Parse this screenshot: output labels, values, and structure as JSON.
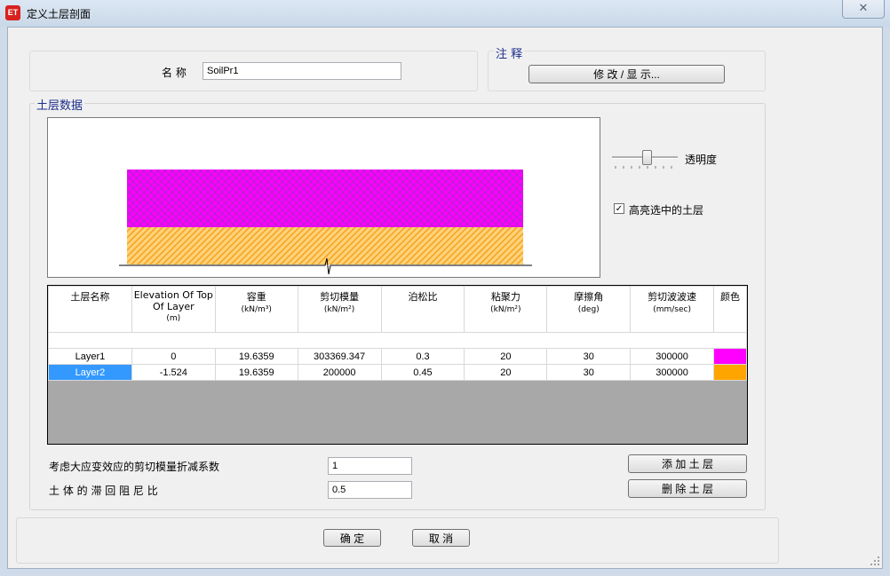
{
  "window": {
    "title": "定义土层剖面",
    "app_icon_text": "ET",
    "close_symbol": "✕"
  },
  "name_section": {
    "label": "名 称",
    "value": "SoilPr1"
  },
  "notes": {
    "legend": "注 释",
    "button": "修 改 / 显 示..."
  },
  "soil_data": {
    "legend": "土层数据",
    "transparency_label": "透明度",
    "highlight_label": "高亮选中的土层",
    "highlight_checked": true,
    "columns": [
      {
        "label": "土层名称",
        "unit": ""
      },
      {
        "label": "Elevation Of Top Of Layer",
        "unit": "(m)"
      },
      {
        "label": "容重",
        "unit": "(kN/m³)"
      },
      {
        "label": "剪切模量",
        "unit": "(kN/m²)"
      },
      {
        "label": "泊松比",
        "unit": ""
      },
      {
        "label": "粘聚力",
        "unit": "(kN/m²)"
      },
      {
        "label": "摩擦角",
        "unit": "(deg)"
      },
      {
        "label": "剪切波波速",
        "unit": "(mm/sec)"
      },
      {
        "label": "颜色",
        "unit": ""
      }
    ],
    "rows": [
      {
        "cells": [
          "Layer1",
          "0",
          "19.6359",
          "303369.347",
          "0.3",
          "20",
          "30",
          "300000"
        ],
        "color": "#ff00ff",
        "selected": false
      },
      {
        "cells": [
          "Layer2",
          "-1.524",
          "19.6359",
          "200000",
          "0.45",
          "20",
          "30",
          "300000"
        ],
        "color": "#ffa500",
        "selected": true
      }
    ]
  },
  "params": {
    "reduction_label": "考虑大应变效应的剪切模量折减系数",
    "reduction_value": "1",
    "damping_label": "土 体 的 滞 回 阻 尼 比",
    "damping_value": "0.5"
  },
  "buttons": {
    "add": "添 加 土 层",
    "delete": "删 除 土 层",
    "ok": "确 定",
    "cancel": "取 消"
  },
  "colors": {
    "layer1": "#ff00ff",
    "layer2": "#ffa500",
    "selection": "#3399ff",
    "legend_text": "#1c2e8c"
  }
}
